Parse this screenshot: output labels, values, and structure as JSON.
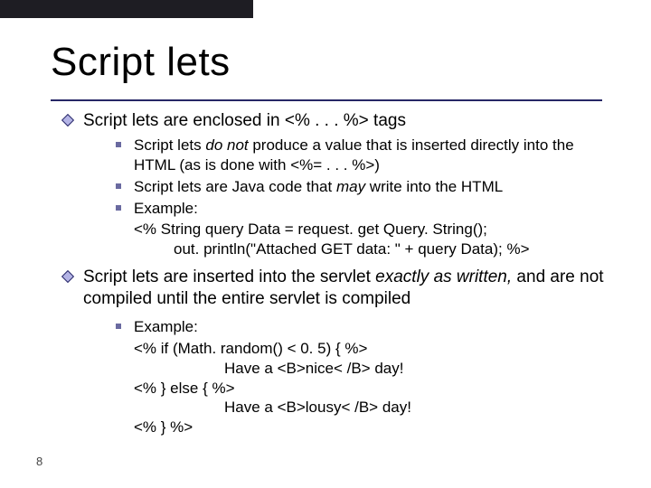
{
  "title": "Script lets",
  "page_number": "8",
  "bullets": {
    "b1": {
      "pre": "Script lets are enclosed in ",
      "code1": "<% . . . %>",
      "post": " tags",
      "sub": {
        "s1": {
          "pre": "Script lets ",
          "em1": "do not",
          "mid": " produce a value that is inserted directly into the HTML (as is done with ",
          "code": "<%= . . . %>",
          "post": ")"
        },
        "s2": {
          "pre": "Script lets are Java code that ",
          "em1": "may",
          "post": " write into the HTML"
        },
        "s3": {
          "label": "Example:",
          "line1": "<% String query Data = request. get Query. String();",
          "line2": "out. println(\"Attached GET data: \" + query Data); %>"
        }
      }
    },
    "b2": {
      "pre": "Script lets are inserted into the servlet ",
      "em1": "exactly as written,",
      "post": " and are not compiled until the entire servlet is compiled",
      "sub": {
        "s1": {
          "label": "Example:",
          "l1": "<% if (Math. random() < 0. 5) { %>",
          "l2": "Have a <B>nice< /B> day!",
          "l3": "<% } else { %>",
          "l4": "Have a <B>lousy< /B> day!",
          "l5": "<% } %>"
        }
      }
    }
  }
}
